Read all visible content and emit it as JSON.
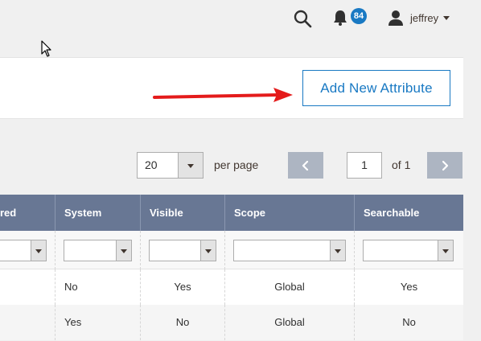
{
  "header": {
    "notification_count": "84",
    "user_name": "jeffrey"
  },
  "toolbar": {
    "add_button_label": "Add New Attribute"
  },
  "pager": {
    "page_size": "20",
    "per_page_label": "per page",
    "current_page": "1",
    "of_label": "of 1"
  },
  "grid": {
    "columns": [
      "red",
      "System",
      "Visible",
      "Scope",
      "Searchable"
    ],
    "rows": [
      {
        "system": "No",
        "visible": "Yes",
        "scope": "Global",
        "searchable": "Yes"
      },
      {
        "system": "Yes",
        "visible": "No",
        "scope": "Global",
        "searchable": "No"
      }
    ]
  },
  "colors": {
    "accent": "#1979c3",
    "header_bg": "#687794",
    "arrow": "#e41b1b"
  },
  "icons": [
    "search-icon",
    "bell-icon",
    "user-icon",
    "caret-down-icon",
    "cursor-icon",
    "chevron-left-icon",
    "chevron-right-icon",
    "arrow-annotation"
  ]
}
